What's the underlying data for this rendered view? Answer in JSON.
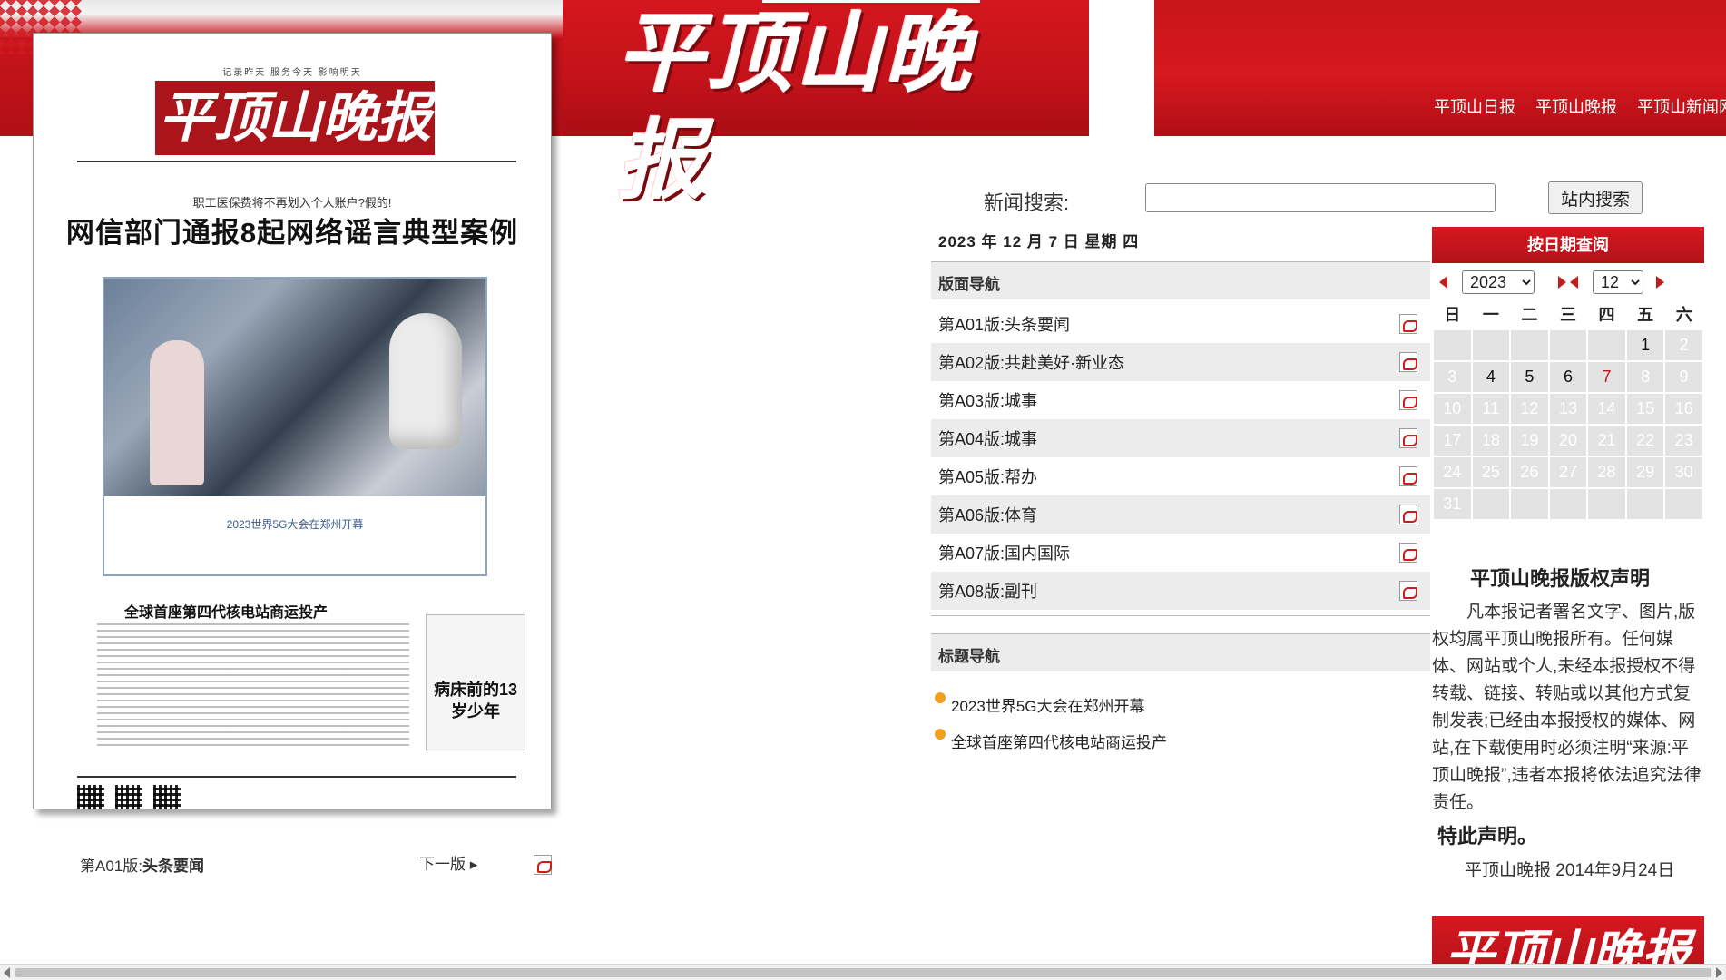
{
  "site": {
    "logo_text": "平顶山晚报",
    "top_links": [
      "平顶山日报",
      "平顶山晚报",
      "平顶山新闻网"
    ]
  },
  "paper": {
    "slogan": "记录昨天 服务今天 影响明天",
    "masthead": "平顶山晚报",
    "kicker": "职工医保费将不再划入个人账户?假的!",
    "headline": "网信部门通报8起网络谣言典型案例",
    "photo_caption": "2023世界5G大会在郑州开幕",
    "subhead": "全球首座第四代核电站商运投产",
    "sidebox_title": "病床前的13岁少年"
  },
  "bottom": {
    "page_label_prefix": "第A01版:",
    "page_label_name": "头条要闻",
    "next_label": "下一版"
  },
  "search": {
    "label": "新闻搜索:",
    "value": "",
    "button": "站内搜索"
  },
  "date_line": "2023 年 12 月 7 日  星期 四",
  "nav": {
    "editions_header": "版面导航",
    "editions": [
      "第A01版:头条要闻",
      "第A02版:共赴美好·新业态",
      "第A03版:城事",
      "第A04版:城事",
      "第A05版:帮办",
      "第A06版:体育",
      "第A07版:国内国际",
      "第A08版:副刊"
    ],
    "headlines_header": "标题导航",
    "headlines": [
      "2023世界5G大会在郑州开幕",
      "全球首座第四代核电站商运投产"
    ]
  },
  "calendar": {
    "title": "按日期查阅",
    "year": "2023",
    "month": "12",
    "weekdays": [
      "日",
      "一",
      "二",
      "三",
      "四",
      "五",
      "六"
    ],
    "weeks": [
      [
        "",
        "",
        "",
        "",
        "",
        "1",
        "2"
      ],
      [
        "3",
        "4",
        "5",
        "6",
        "7",
        "8",
        "9"
      ],
      [
        "10",
        "11",
        "12",
        "13",
        "14",
        "15",
        "16"
      ],
      [
        "17",
        "18",
        "19",
        "20",
        "21",
        "22",
        "23"
      ],
      [
        "24",
        "25",
        "26",
        "27",
        "28",
        "29",
        "30"
      ],
      [
        "31",
        "",
        "",
        "",
        "",
        "",
        ""
      ]
    ],
    "available_days": [
      "1",
      "4",
      "5",
      "6",
      "7"
    ],
    "selected_day": "7"
  },
  "copyright": {
    "title": "平顶山晚报版权声明",
    "body": "凡本报记者署名文字、图片,版权均属平顶山晚报所有。任何媒体、网站或个人,未经本报授权不得转载、链接、转贴或以其他方式复制发表;已经由本报授权的媒体、网站,在下载使用时必须注明“来源:平顶山晚报”,违者本报将依法追究法律责任。",
    "special": "特此声明。",
    "signature": "平顶山晚报 2014年9月24日"
  },
  "colors": {
    "brand_red": "#c8141b",
    "row_gray": "#ececec",
    "today_red": "#c0161c"
  }
}
